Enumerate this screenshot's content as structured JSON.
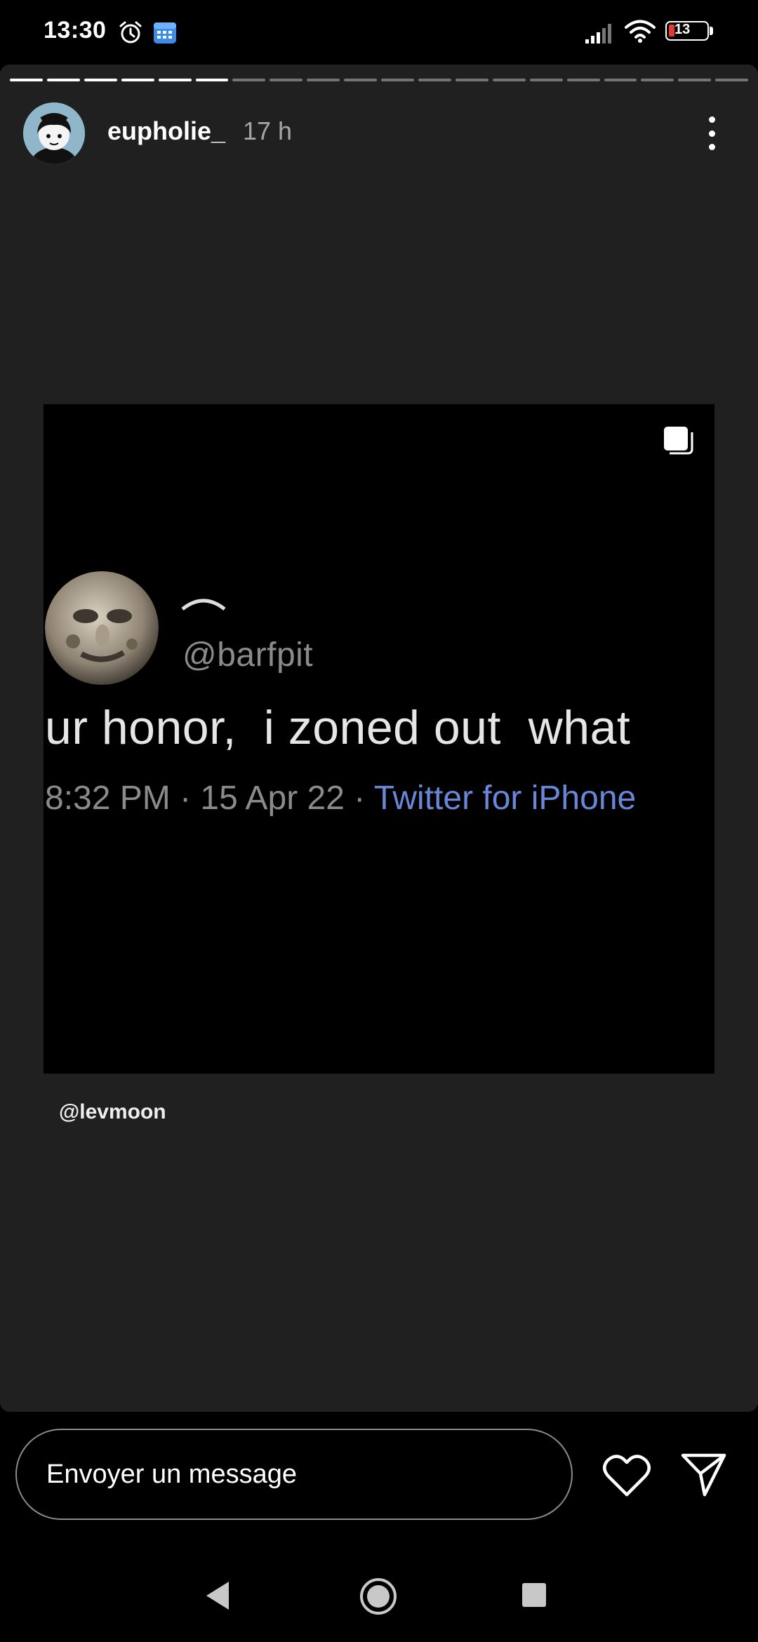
{
  "status_bar": {
    "time": "13:30",
    "battery_level": "13",
    "icons": [
      "alarm-icon",
      "calendar-icon",
      "signal-icon",
      "wifi-icon",
      "battery-icon"
    ]
  },
  "story": {
    "progress": {
      "segments": 20,
      "completed": 6
    },
    "username": "eupholie_",
    "age": "17 h",
    "mention": "@levmoon"
  },
  "media": {
    "tweet": {
      "handle": "@barfpit",
      "text": "ur honor,  i zoned out  what",
      "meta": "8:32 PM · 15 Apr 22 · ",
      "source": "Twitter for iPhone"
    }
  },
  "reply": {
    "placeholder": "Envoyer un message"
  },
  "colors": {
    "background": "#202020",
    "tweet_link": "#6a86d6",
    "battery_low": "#e53935"
  }
}
